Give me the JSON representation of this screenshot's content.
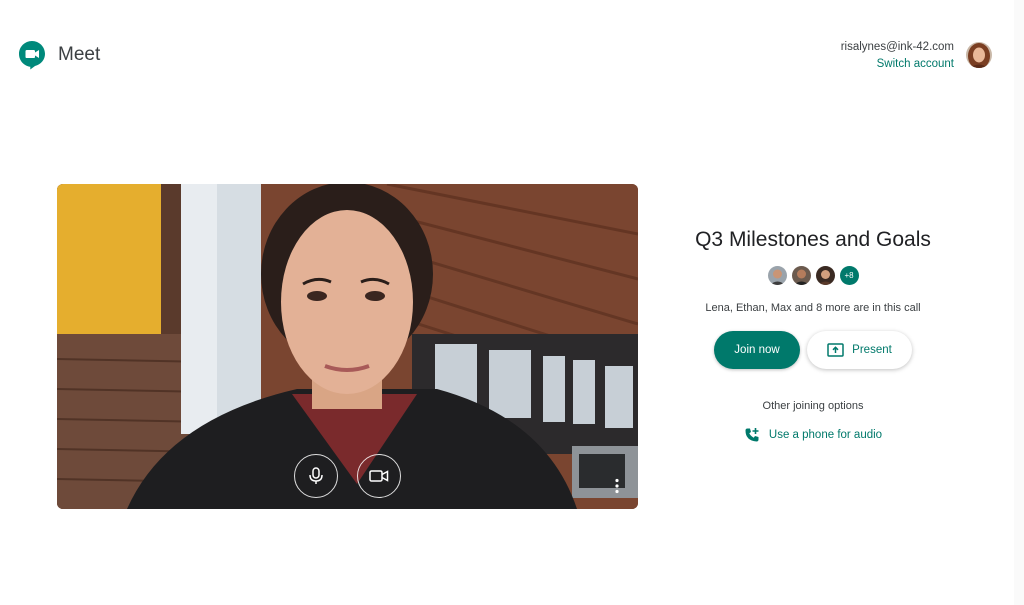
{
  "header": {
    "app_name": "Meet",
    "account_email": "risalynes@ink-42.com",
    "switch_account_label": "Switch account"
  },
  "meeting": {
    "title": "Q3 Milestones and Goals",
    "more_participants_badge": "+8",
    "in_call_text": "Lena, Ethan, Max and 8 more are in this call",
    "join_label": "Join now",
    "present_label": "Present",
    "other_options_label": "Other joining options",
    "phone_audio_label": "Use a phone for audio"
  },
  "preview": {
    "mic_icon": "mic-icon",
    "camera_icon": "videocam-icon",
    "more_icon": "more-vert-icon"
  },
  "colors": {
    "accent": "#00796b",
    "text": "#202124",
    "secondary_text": "#3c4043"
  }
}
